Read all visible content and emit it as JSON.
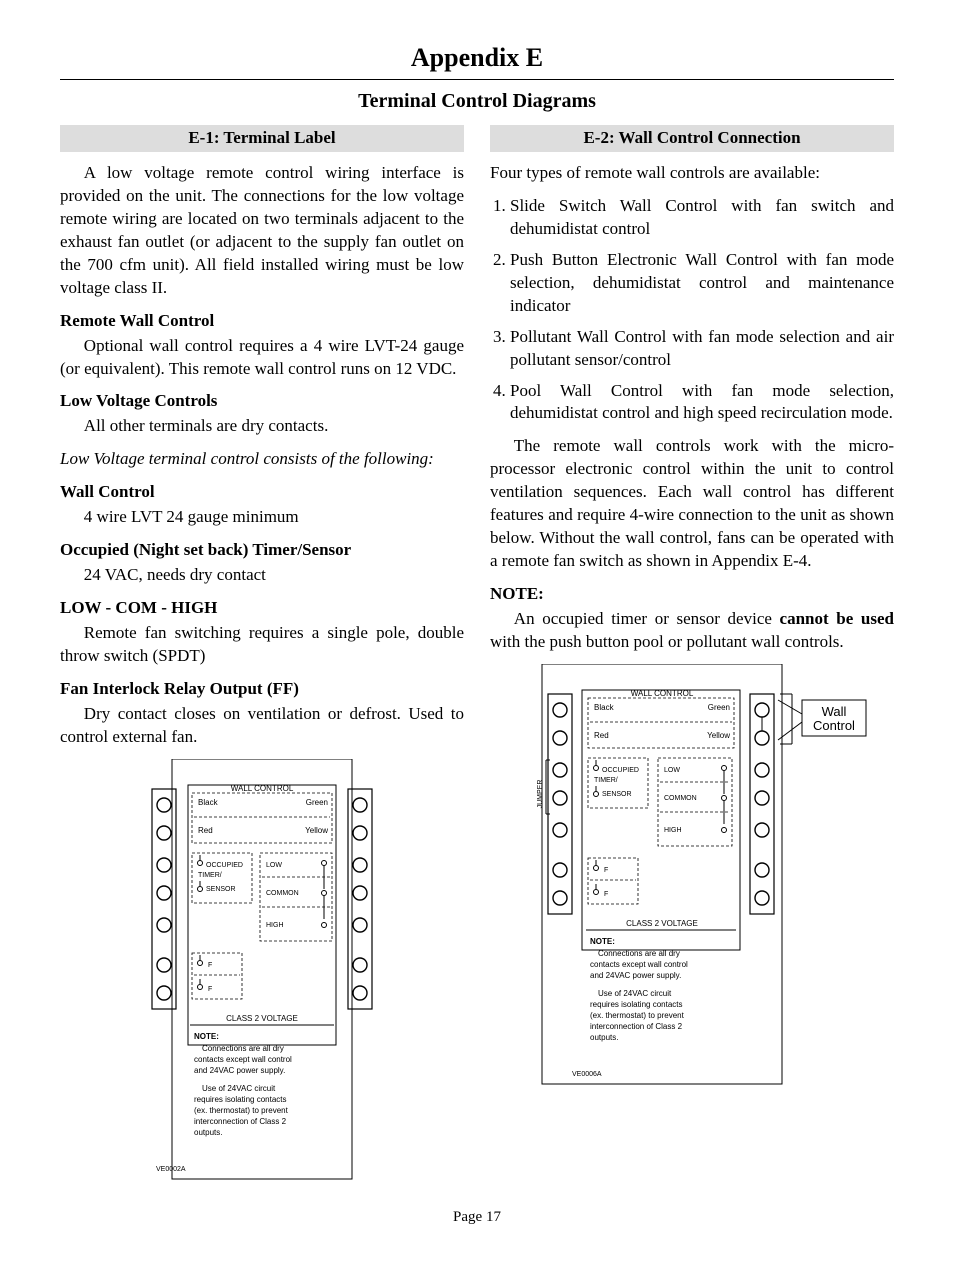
{
  "appendix_title": "Appendix E",
  "subtitle": "Terminal Control Diagrams",
  "page_number": "Page 17",
  "left": {
    "section_title": "E-1: Terminal Label",
    "intro": "A low voltage remote control wiring interface is provided on the unit. The connections for the low voltage remote wiring are located on two terminals adjacent to the exhaust fan outlet (or adjacent to the supply fan outlet on the 700 cfm unit). All field installed wiring must be low voltage class II.",
    "remote_head": "Remote Wall Control",
    "remote_body": "Optional wall control requires a 4 wire LVT-24 gauge (or equivalent). This remote wall control runs on 12 VDC.",
    "low_volt_head": "Low Voltage Controls",
    "low_volt_body": "All other terminals are dry contacts.",
    "italic_line": "Low Voltage terminal control consists of the following:",
    "wall_head": "Wall Control",
    "wall_body": "4 wire LVT 24 gauge minimum",
    "occ_head": "Occupied (Night set back) Timer/Sensor",
    "occ_body": "24 VAC, needs dry contact",
    "lch_head": "LOW - COM - HIGH",
    "lch_body": "Remote fan switching requires a single pole, double throw switch (SPDT)",
    "fan_head": "Fan Interlock Relay Output (FF)",
    "fan_body": "Dry contact closes on ventilation or defrost. Used to control external fan."
  },
  "right": {
    "section_title": "E-2: Wall Control Connection",
    "intro": "Four types of remote wall controls are available:",
    "items": {
      "i1": "Slide Switch Wall Control with fan switch and dehumidistat control",
      "i2": "Push Button Electronic Wall Control with fan mode selection, dehumidistat control and maintenance indicator",
      "i3": "Pollutant Wall Control with fan mode selection and air pollutant sensor/control",
      "i4": "Pool Wall Control with fan mode selection, dehumidistat control and high speed recirculation mode."
    },
    "para2": "The remote wall controls work with the micro-processor electronic control within the unit to control ventilation sequences. Each wall control has different features and require 4-wire connection to the unit as shown below. Without the wall control, fans can be operated with a remote fan switch as shown in Appendix E-4.",
    "note_head": "NOTE:",
    "note_body_a": "An occupied timer or sensor device ",
    "note_body_bold": "cannot be used",
    "note_body_b": " with the push button pool or pollutant wall controls."
  },
  "diagram": {
    "wall_control_label": "WALL CONTROL",
    "black": "Black",
    "green": "Green",
    "red": "Red",
    "yellow": "Yellow",
    "occupied": "OCCUPIED",
    "timer": "TIMER/",
    "sensor": "SENSOR",
    "low": "LOW",
    "common": "COMMON",
    "high": "HIGH",
    "f": "F",
    "class2": "CLASS 2 VOLTAGE",
    "note": "NOTE:",
    "note1a": "Connections are all dry",
    "note1b": "contacts except wall control",
    "note1c": "and 24VAC power supply.",
    "note2a": "Use of 24VAC circuit",
    "note2b": "requires isolating contacts",
    "note2c": "(ex. thermostat) to prevent",
    "note2d": "interconnection of Class 2",
    "note2e": "outputs.",
    "id_left": "VE0002A",
    "id_right": "VE0006A",
    "jumper": "JUMPER",
    "callout": "Wall Control",
    "callout_a": "Wall",
    "callout_b": "Control"
  }
}
